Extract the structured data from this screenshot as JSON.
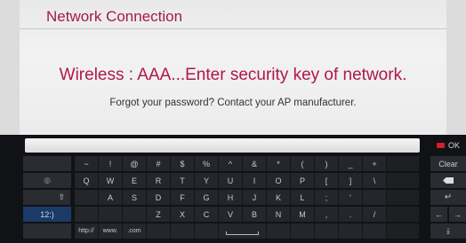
{
  "dialog": {
    "title": "Network Connection",
    "message": "Wireless : AAA...Enter security key of network.",
    "submessage": "Forgot your password? Contact your AP manufacturer."
  },
  "keyboard": {
    "input_value": "",
    "ok_label": "OK",
    "clear_label": "Clear",
    "row1": [
      "~",
      "!",
      "@",
      "#",
      "$",
      "%",
      "^",
      "&",
      "*",
      "(",
      ")",
      "_",
      "+"
    ],
    "row2": [
      "Q",
      "W",
      "E",
      "R",
      "T",
      "Y",
      "U",
      "I",
      "O",
      "P",
      "[",
      "]",
      "\\"
    ],
    "row3": [
      "A",
      "S",
      "D",
      "F",
      "G",
      "H",
      "J",
      "K",
      "L",
      ";",
      "'"
    ],
    "row4": [
      "Z",
      "X",
      "C",
      "V",
      "B",
      "N",
      "M",
      ",",
      ".",
      "/"
    ],
    "row5": [
      "http://",
      "www.",
      ".com"
    ],
    "mode_label": "12:)",
    "shift_glyph": "⇧",
    "left_arrow": "←",
    "right_arrow": "→",
    "download_glyph": "⤓",
    "colors": {
      "accent": "#b0174c",
      "mode_key": "#1c3a66",
      "ok_indicator": "#d31e2c"
    }
  }
}
